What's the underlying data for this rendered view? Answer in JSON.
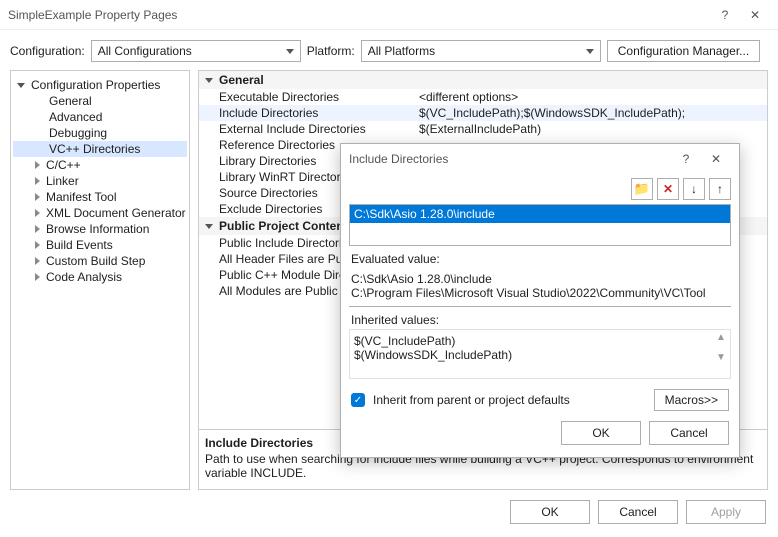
{
  "window": {
    "title": "SimpleExample Property Pages",
    "help": "?",
    "close": "✕"
  },
  "config_row": {
    "config_label": "Configuration:",
    "config_value": "All Configurations",
    "platform_label": "Platform:",
    "platform_value": "All Platforms",
    "manager_button": "Configuration Manager..."
  },
  "tree": {
    "root": "Configuration Properties",
    "items": [
      {
        "label": "General",
        "indent": 2,
        "caret": ""
      },
      {
        "label": "Advanced",
        "indent": 2,
        "caret": ""
      },
      {
        "label": "Debugging",
        "indent": 2,
        "caret": ""
      },
      {
        "label": "VC++ Directories",
        "indent": 2,
        "caret": "",
        "selected": true
      },
      {
        "label": "C/C++",
        "indent": 1,
        "caret": "r"
      },
      {
        "label": "Linker",
        "indent": 1,
        "caret": "r"
      },
      {
        "label": "Manifest Tool",
        "indent": 1,
        "caret": "r"
      },
      {
        "label": "XML Document Generator",
        "indent": 1,
        "caret": "r"
      },
      {
        "label": "Browse Information",
        "indent": 1,
        "caret": "r"
      },
      {
        "label": "Build Events",
        "indent": 1,
        "caret": "r"
      },
      {
        "label": "Custom Build Step",
        "indent": 1,
        "caret": "r"
      },
      {
        "label": "Code Analysis",
        "indent": 1,
        "caret": "r"
      }
    ]
  },
  "prop_groups": [
    {
      "label": "General",
      "rows": [
        {
          "name": "Executable Directories",
          "value": "<different options>"
        },
        {
          "name": "Include Directories",
          "value": "$(VC_IncludePath);$(WindowsSDK_IncludePath);",
          "selected": true
        },
        {
          "name": "External Include Directories",
          "value": "$(ExternalIncludePath)"
        },
        {
          "name": "Reference Directories",
          "value": ""
        },
        {
          "name": "Library Directories",
          "value": ""
        },
        {
          "name": "Library WinRT Directories",
          "value": ""
        },
        {
          "name": "Source Directories",
          "value": ""
        },
        {
          "name": "Exclude Directories",
          "value": ""
        }
      ]
    },
    {
      "label": "Public Project Content",
      "rows": [
        {
          "name": "Public Include Directories",
          "value": ""
        },
        {
          "name": "All Header Files are Public",
          "value": ""
        },
        {
          "name": "Public C++ Module Directories",
          "value": ""
        },
        {
          "name": "All Modules are Public",
          "value": ""
        }
      ]
    }
  ],
  "description": {
    "title": "Include Directories",
    "text": "Path to use when searching for include files while building a VC++ project. Corresponds to environment variable INCLUDE."
  },
  "footer": {
    "ok": "OK",
    "cancel": "Cancel",
    "apply": "Apply"
  },
  "dialog": {
    "title": "Include Directories",
    "help": "?",
    "close": "✕",
    "list_item": "C:\\Sdk\\Asio 1.28.0\\include",
    "eval_label": "Evaluated value:",
    "eval_lines": [
      "C:\\Sdk\\Asio 1.28.0\\include",
      "C:\\Program Files\\Microsoft Visual Studio\\2022\\Community\\VC\\Tool"
    ],
    "inherit_label": "Inherited values:",
    "inherit_lines": [
      "$(VC_IncludePath)",
      "$(WindowsSDK_IncludePath)"
    ],
    "checkbox_label": "Inherit from parent or project defaults",
    "macros_button": "Macros>>",
    "ok": "OK",
    "cancel": "Cancel"
  }
}
